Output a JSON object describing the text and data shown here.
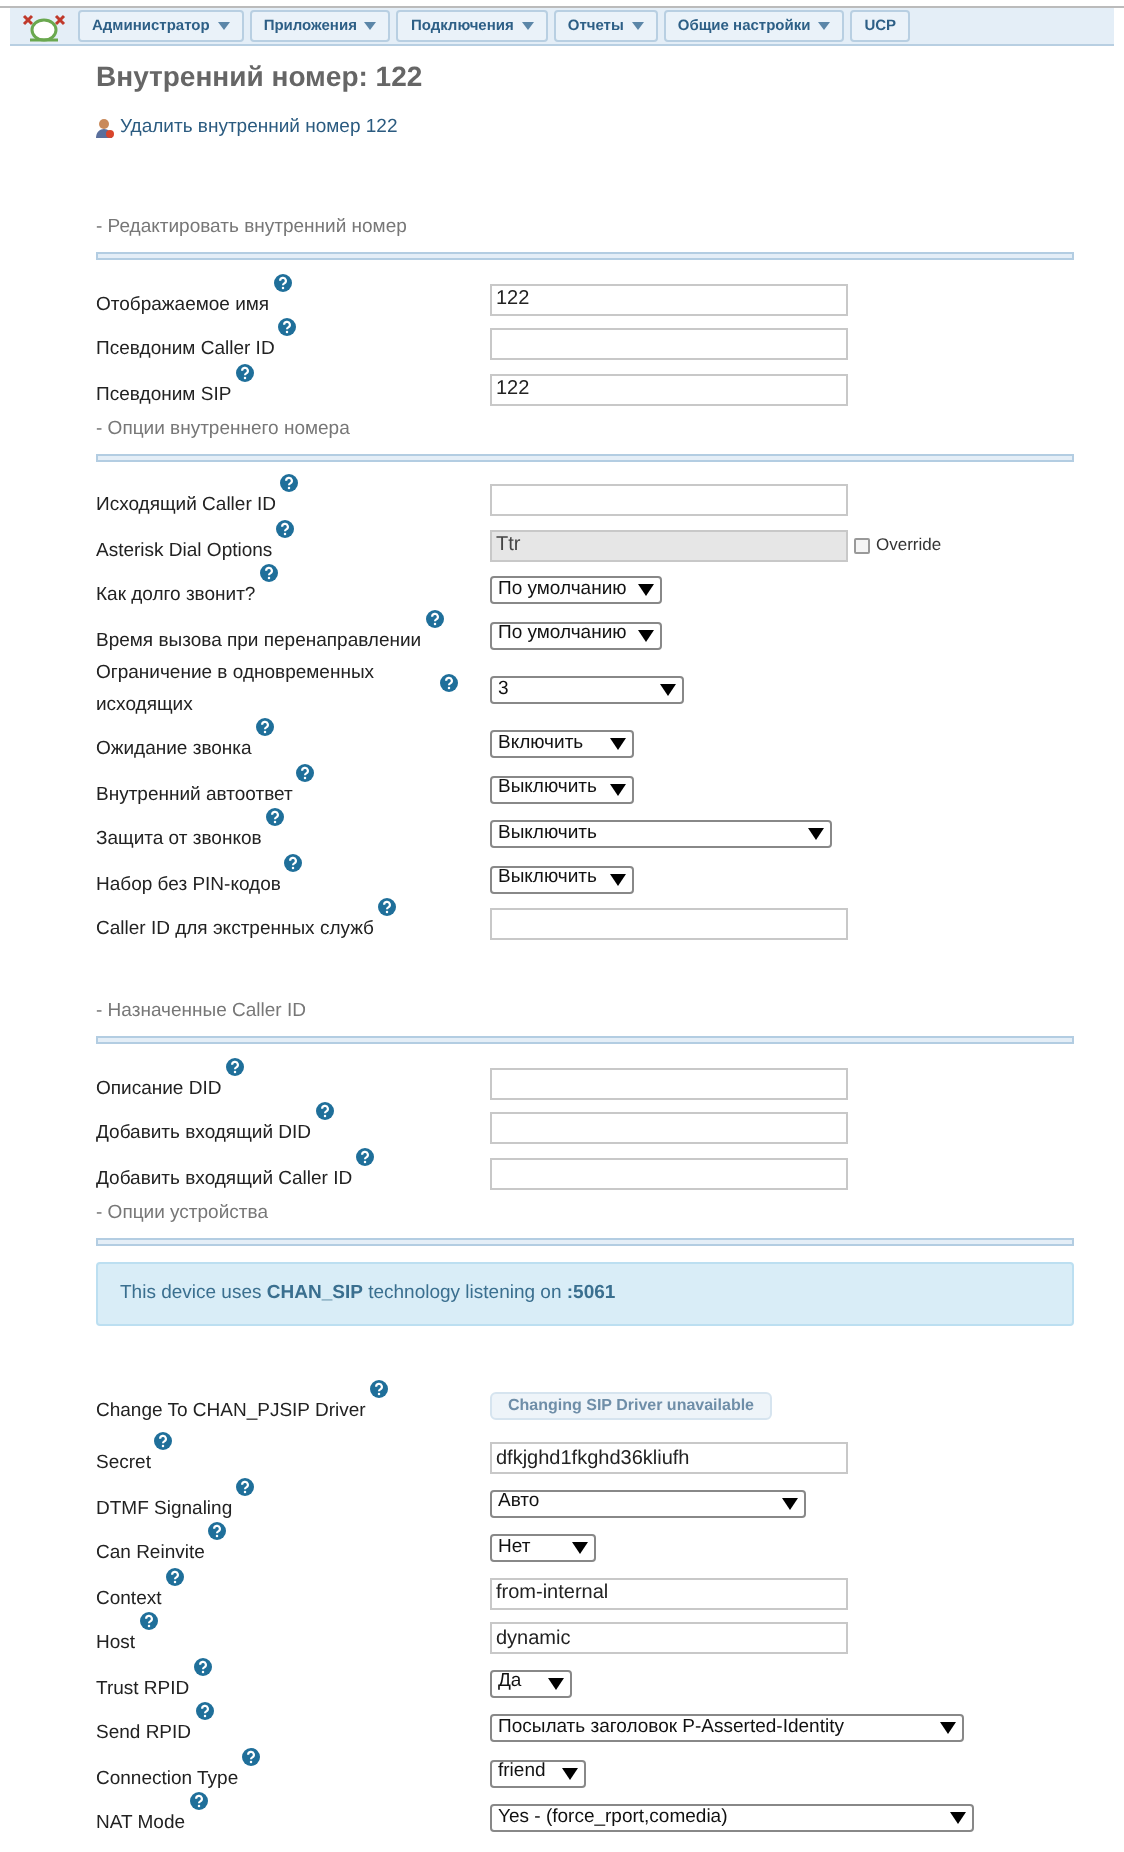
{
  "nav": [
    {
      "label": "Администратор",
      "dropdown": true
    },
    {
      "label": "Приложения",
      "dropdown": true
    },
    {
      "label": "Подключения",
      "dropdown": true
    },
    {
      "label": "Отчеты",
      "dropdown": true
    },
    {
      "label": "Общие настройки",
      "dropdown": true
    },
    {
      "label": "UCP",
      "dropdown": false
    }
  ],
  "title": "Внутренний номер: 122",
  "delete_link": "Удалить внутренний номер 122",
  "sections": [
    {
      "heading": "- Редактировать внутренний номер",
      "rows": [
        {
          "kind": "text",
          "label": "Отображаемое имя",
          "value": "122"
        },
        {
          "kind": "text",
          "label": "Псевдоним Caller ID"
        },
        {
          "kind": "text",
          "label": "Псевдоним SIP",
          "value": "122"
        }
      ]
    },
    {
      "heading": "- Опции внутреннего номера",
      "rows": [
        {
          "kind": "text",
          "label": "Исходящий Caller ID"
        },
        {
          "kind": "override",
          "label": "Asterisk Dial Options",
          "value": "Ttr",
          "disabled": true,
          "override_label": "Override",
          "checked": false
        },
        {
          "kind": "select",
          "label": "Как долго звонит?",
          "value": "По умолчанию"
        },
        {
          "kind": "select",
          "label": "Время вызова при перенаправлении",
          "value": "По умолчанию"
        },
        {
          "kind": "select",
          "label": "Ограничение в одновременных исходящих",
          "value": "3"
        },
        {
          "kind": "select",
          "label": "Ожидание звонка",
          "value": "Включить"
        },
        {
          "kind": "select",
          "label": "Внутренний автоответ",
          "value": "Выключить"
        },
        {
          "kind": "select",
          "label": "Защита от звонков",
          "value": "Выключить"
        },
        {
          "kind": "select",
          "label": "Набор без PIN-кодов",
          "value": "Выключить"
        },
        {
          "kind": "text",
          "label": "Caller ID для экстренных служб"
        }
      ]
    },
    {
      "heading": "- Назначенные Caller ID",
      "rows": [
        {
          "kind": "text",
          "label": "Описание DID"
        },
        {
          "kind": "text",
          "label": "Добавить входящий DID"
        },
        {
          "kind": "text",
          "label": "Добавить входящий Caller ID"
        }
      ]
    },
    {
      "heading": "- Опции устройства",
      "info": "This device uses **CHAN_SIP** technology listening on **:5061**",
      "rows": [
        {
          "kind": "button",
          "label": "Change To CHAN_PJSIP Driver",
          "value": "Changing SIP Driver unavailable",
          "disabled": true
        },
        {
          "kind": "text",
          "label": "Secret",
          "value": "dfkjghd1fkghd36kliufh"
        },
        {
          "kind": "select",
          "label": "DTMF Signaling",
          "value": "Авто"
        },
        {
          "kind": "select",
          "label": "Can Reinvite",
          "value": "Нет"
        },
        {
          "kind": "text",
          "label": "Context",
          "value": "from-internal"
        },
        {
          "kind": "text",
          "label": "Host",
          "value": "dynamic"
        },
        {
          "kind": "select",
          "label": "Trust RPID",
          "value": "Да"
        },
        {
          "kind": "select",
          "label": "Send RPID",
          "value": "Посылать заголовок P-Asserted-Identity"
        },
        {
          "kind": "select",
          "label": "Connection Type",
          "value": "friend"
        },
        {
          "kind": "select",
          "label": "NAT Mode",
          "value": "Yes - (force_rport,comedia)"
        }
      ]
    }
  ]
}
